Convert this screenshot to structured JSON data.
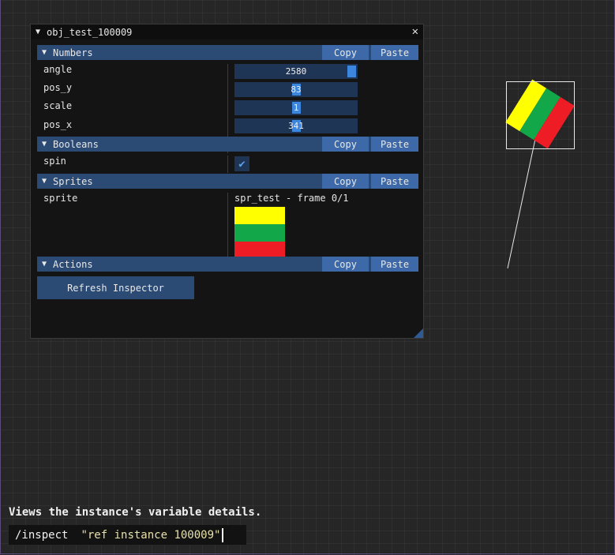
{
  "window": {
    "title": "obj_test_100009"
  },
  "labels": {
    "copy": "Copy",
    "paste": "Paste"
  },
  "sections": {
    "numbers": {
      "title": "Numbers"
    },
    "booleans": {
      "title": "Booleans"
    },
    "sprites": {
      "title": "Sprites"
    },
    "actions": {
      "title": "Actions"
    }
  },
  "fields": {
    "angle": {
      "label": "angle",
      "value": "2580",
      "slider_fraction": 1.0
    },
    "pos_y": {
      "label": "pos_y",
      "value": "83",
      "slider_fraction": 0.5
    },
    "scale": {
      "label": "scale",
      "value": "1",
      "slider_fraction": 0.5
    },
    "pos_x": {
      "label": "pos_x",
      "value": "341",
      "slider_fraction": 0.5
    },
    "spin": {
      "label": "spin",
      "checked": true
    },
    "sprite": {
      "label": "sprite",
      "text": "spr_test - frame 0/1",
      "stripe_colors": [
        "#ffff00",
        "#12a84a",
        "#ee1c25"
      ]
    }
  },
  "actions": {
    "refresh_label": "Refresh Inspector"
  },
  "console": {
    "description": "Views the instance's variable details.",
    "command": "/inspect",
    "argument": "\"ref instance 100009\""
  },
  "colors": {
    "header": "#2b4a74",
    "button": "#3d69a8",
    "accent": "#3d86dd"
  }
}
